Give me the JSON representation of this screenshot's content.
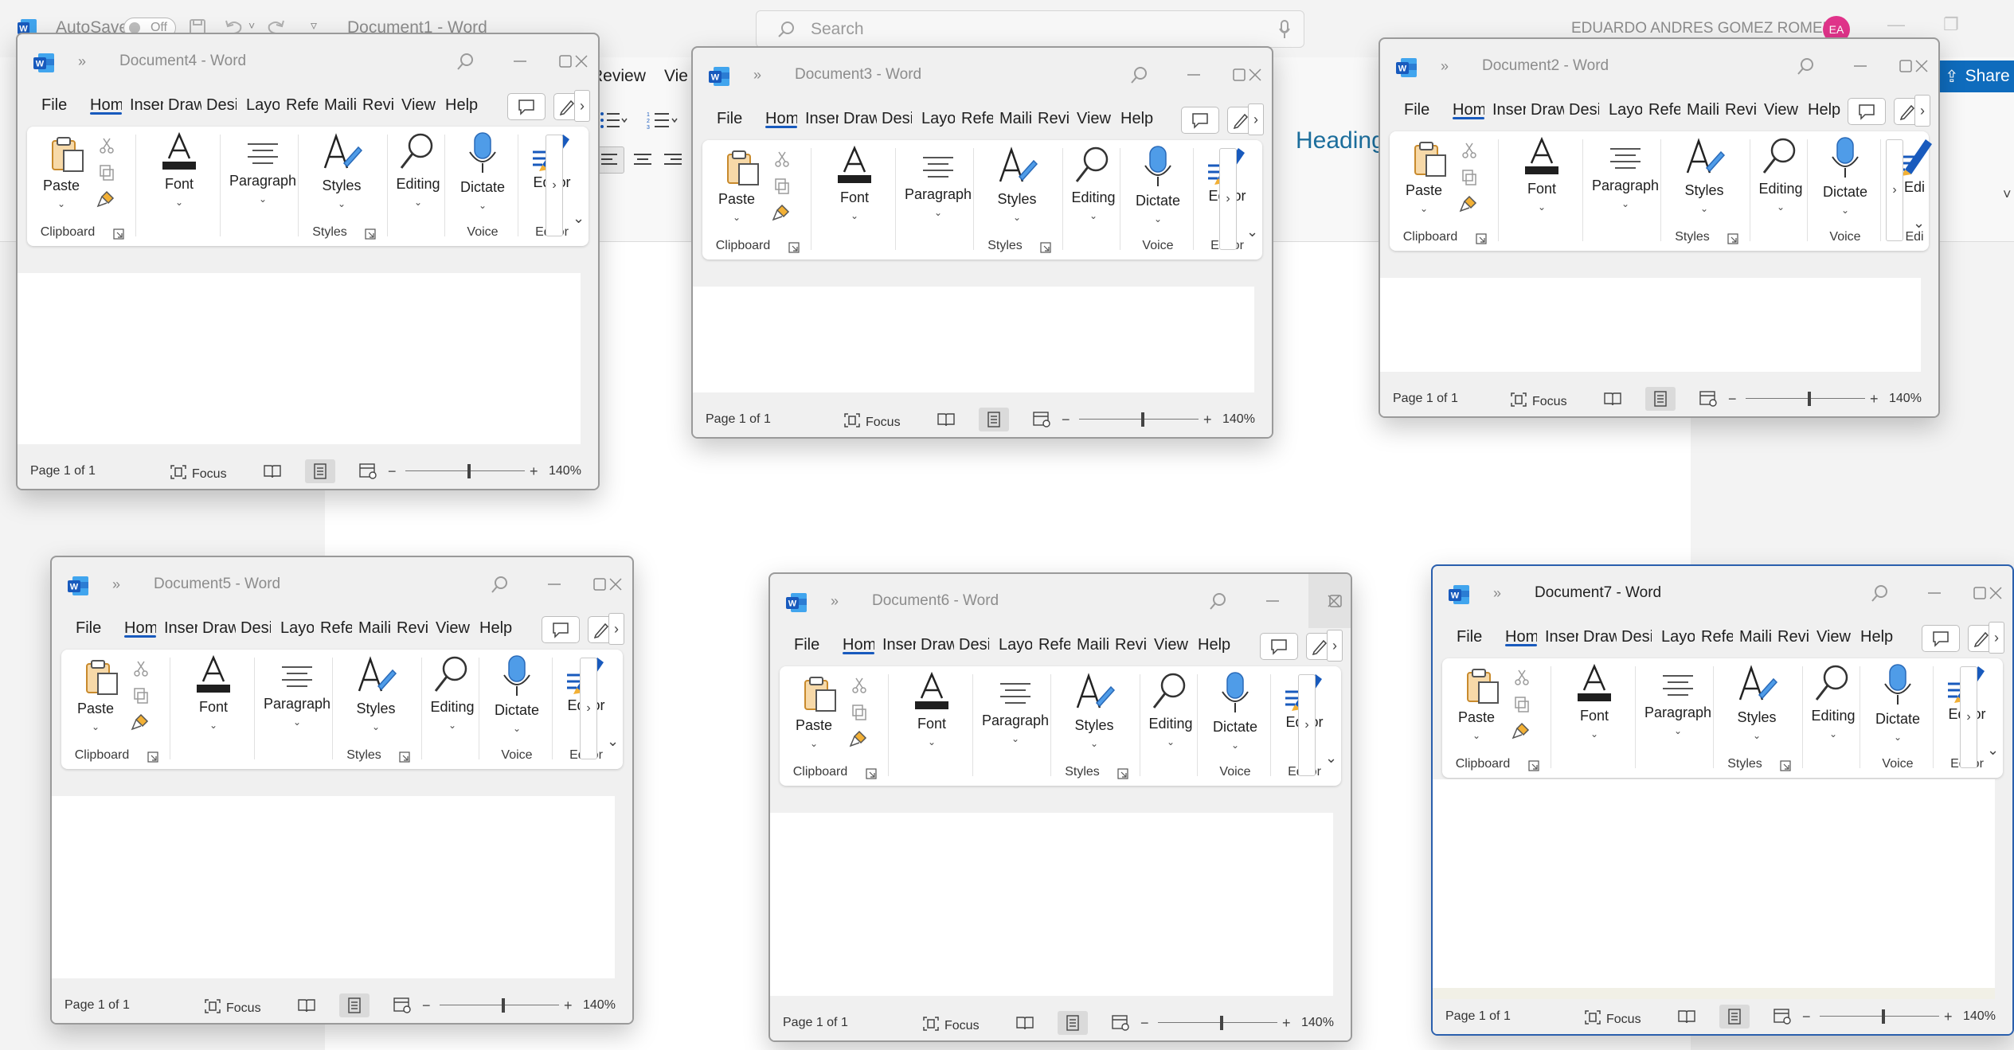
{
  "background_window": {
    "autosave_label": "AutoSave",
    "autosave_state": "Off",
    "title": "Document1 - Word",
    "search_placeholder": "Search",
    "user_name": "EDUARDO ANDRES GOMEZ ROMERO",
    "user_initials": "EA",
    "share_label": "Share",
    "tab_review": "Review",
    "tab_view_partial": "Vie",
    "heading_style": "Heading"
  },
  "windows": [
    {
      "id": "doc4",
      "title": "Document4 - Word",
      "tabs": [
        "File",
        "Hom",
        "Inser",
        "Draw",
        "Desi",
        "Layo",
        "Refe",
        "Maili",
        "Revi",
        "View",
        "Help"
      ],
      "groups": {
        "clipboard": "Clipboard",
        "styles": "Styles",
        "voice": "Voice",
        "editor": "Editor"
      },
      "buttons": {
        "paste": "Paste",
        "font": "Font",
        "paragraph": "Paragraph",
        "styles": "Styles",
        "editing": "Editing",
        "dictate": "Dictate",
        "editor": "Editor"
      },
      "status": {
        "page": "Page 1 of 1",
        "focus": "Focus",
        "zoom": "140%"
      }
    },
    {
      "id": "doc3",
      "title": "Document3 - Word",
      "tabs": [
        "File",
        "Hom",
        "Inser",
        "Draw",
        "Desi",
        "Layo",
        "Refe",
        "Maili",
        "Revi",
        "View",
        "Help"
      ],
      "groups": {
        "clipboard": "Clipboard",
        "styles": "Styles",
        "voice": "Voice",
        "editor": "Editor"
      },
      "buttons": {
        "paste": "Paste",
        "font": "Font",
        "paragraph": "Paragraph",
        "styles": "Styles",
        "editing": "Editing",
        "dictate": "Dictate",
        "editor": "Editor"
      },
      "status": {
        "page": "Page 1 of 1",
        "focus": "Focus",
        "zoom": "140%"
      }
    },
    {
      "id": "doc2",
      "title": "Document2 - Word",
      "tabs": [
        "File",
        "Hom",
        "Inser",
        "Draw",
        "Desi",
        "Layo",
        "Refe",
        "Maili",
        "Revi",
        "View",
        "Help"
      ],
      "groups": {
        "clipboard": "Clipboard",
        "styles": "Styles",
        "voice": "Voice",
        "editor": "Edi"
      },
      "buttons": {
        "paste": "Paste",
        "font": "Font",
        "paragraph": "Paragraph",
        "styles": "Styles",
        "editing": "Editing",
        "dictate": "Dictate",
        "editor": "Edi"
      },
      "status": {
        "page": "Page 1 of 1",
        "focus": "Focus",
        "zoom": "140%"
      }
    },
    {
      "id": "doc5",
      "title": "Document5 - Word",
      "tabs": [
        "File",
        "Hom",
        "Inser",
        "Draw",
        "Desi",
        "Layo",
        "Refe",
        "Maili",
        "Revi",
        "View",
        "Help"
      ],
      "groups": {
        "clipboard": "Clipboard",
        "styles": "Styles",
        "voice": "Voice",
        "editor": "Editor"
      },
      "buttons": {
        "paste": "Paste",
        "font": "Font",
        "paragraph": "Paragraph",
        "styles": "Styles",
        "editing": "Editing",
        "dictate": "Dictate",
        "editor": "Editor"
      },
      "status": {
        "page": "Page 1 of 1",
        "focus": "Focus",
        "zoom": "140%"
      }
    },
    {
      "id": "doc6",
      "title": "Document6 - Word",
      "tabs": [
        "File",
        "Hom",
        "Inser",
        "Draw",
        "Desi",
        "Layo",
        "Refe",
        "Maili",
        "Revi",
        "View",
        "Help"
      ],
      "groups": {
        "clipboard": "Clipboard",
        "styles": "Styles",
        "voice": "Voice",
        "editor": "Editor"
      },
      "buttons": {
        "paste": "Paste",
        "font": "Font",
        "paragraph": "Paragraph",
        "styles": "Styles",
        "editing": "Editing",
        "dictate": "Dictate",
        "editor": "Editor"
      },
      "status": {
        "page": "Page 1 of 1",
        "focus": "Focus",
        "zoom": "140%"
      }
    },
    {
      "id": "doc7",
      "title": "Document7 - Word",
      "tabs": [
        "File",
        "Hom",
        "Inser",
        "Draw",
        "Desi",
        "Layo",
        "Refe",
        "Maili",
        "Revi",
        "View",
        "Help"
      ],
      "groups": {
        "clipboard": "Clipboard",
        "styles": "Styles",
        "voice": "Voice",
        "editor": "Editor"
      },
      "buttons": {
        "paste": "Paste",
        "font": "Font",
        "paragraph": "Paragraph",
        "styles": "Styles",
        "editing": "Editing",
        "dictate": "Dictate",
        "editor": "Editor"
      },
      "status": {
        "page": "Page 1 of 1",
        "focus": "Focus",
        "zoom": "140%"
      }
    }
  ],
  "colors": {
    "word_blue": "#185abd",
    "active_border": "#2a5fad",
    "avatar": "#e0338a",
    "share": "#0f6cbd",
    "heading": "#1c6e9c"
  }
}
